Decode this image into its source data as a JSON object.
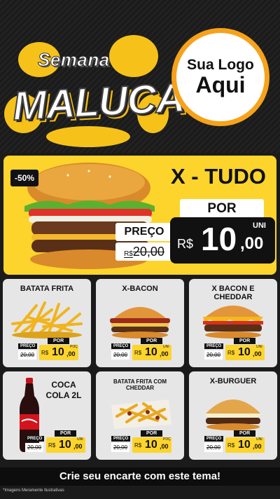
{
  "header": {
    "title_line1": "Semana",
    "title_line2": "MALUCA",
    "logo_line1": "Sua Logo",
    "logo_line2": "Aqui"
  },
  "featured": {
    "discount": "-50%",
    "name": "X - TUDO",
    "por_label": "POR",
    "preco_label": "PREÇO",
    "old_currency": "R$",
    "old_price": "20,00",
    "currency": "R$",
    "price_int": "10",
    "price_dec": ",00",
    "unit": "UNI"
  },
  "cards": [
    {
      "name": "BATATA FRITA",
      "preco_label": "PREÇO",
      "old_price": "20,00",
      "por_label": "POR",
      "currency": "R$",
      "price_int": "10",
      "price_dec": ",00",
      "unit": "POÇ"
    },
    {
      "name": "X-BACON",
      "preco_label": "PREÇO",
      "old_price": "20,00",
      "por_label": "POR",
      "currency": "R$",
      "price_int": "10",
      "price_dec": ",00",
      "unit": "UNI"
    },
    {
      "name": "X BACON E CHEDDAR",
      "preco_label": "PREÇO",
      "old_price": "20,00",
      "por_label": "POR",
      "currency": "R$",
      "price_int": "10",
      "price_dec": ",00",
      "unit": "UNI"
    },
    {
      "name": "COCA COLA 2L",
      "preco_label": "PREÇO",
      "old_price": "20,00",
      "por_label": "POR",
      "currency": "R$",
      "price_int": "10",
      "price_dec": ",00",
      "unit": "UNI"
    },
    {
      "name": "BATATA FRITA COM CHEDDAR",
      "preco_label": "PREÇO",
      "old_price": "20,00",
      "por_label": "POR",
      "currency": "R$",
      "price_int": "10",
      "price_dec": ",00",
      "unit": "POÇ"
    },
    {
      "name": "X-BURGUER",
      "preco_label": "PREÇO",
      "old_price": "20,00",
      "por_label": "POR",
      "currency": "R$",
      "price_int": "10",
      "price_dec": ",00",
      "unit": "UNI"
    }
  ],
  "cta": "Crie seu encarte com este tema!",
  "disclaimer": "*Imagens Meramente Ilustrativas",
  "colors": {
    "accent": "#fdd42b",
    "dark": "#111111",
    "logo_ring": "#f6a21a"
  },
  "icons": [
    "burger-image",
    "fries-image",
    "soda-bottle-image",
    "cheese-fries-image"
  ]
}
